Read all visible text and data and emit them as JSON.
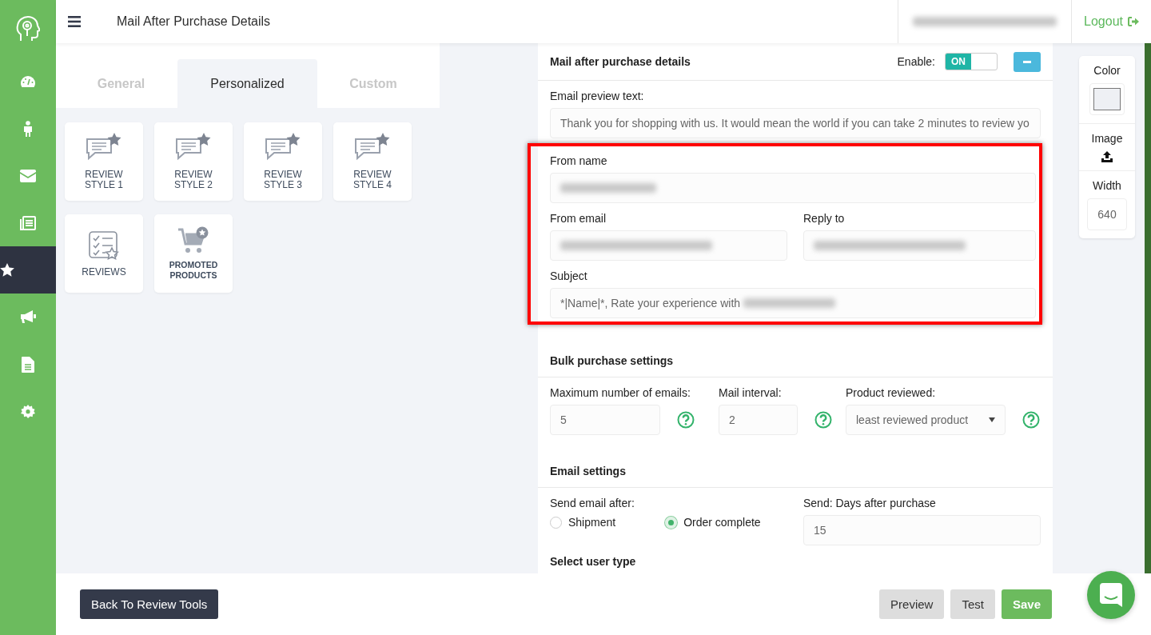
{
  "sidebar": {
    "items": [
      {
        "selected": false
      },
      {
        "selected": false
      },
      {
        "selected": false
      },
      {
        "selected": false
      },
      {
        "selected": true
      },
      {
        "selected": false
      },
      {
        "selected": false
      },
      {
        "selected": false
      }
    ]
  },
  "header": {
    "title": "Mail After Purchase Details",
    "logout": "Logout"
  },
  "tabs": [
    {
      "label": "General",
      "selected": false
    },
    {
      "label": "Personalized",
      "selected": true
    },
    {
      "label": "Custom",
      "selected": false
    }
  ],
  "templates": [
    {
      "label": "REVIEW STYLE 1",
      "kind": "speech"
    },
    {
      "label": "REVIEW STYLE 2",
      "kind": "speech"
    },
    {
      "label": "REVIEW STYLE 3",
      "kind": "speech"
    },
    {
      "label": "REVIEW STYLE 4",
      "kind": "speech"
    },
    {
      "label": "REVIEWS",
      "kind": "checklist"
    },
    {
      "label": "PROMOTED PRODUCTS",
      "kind": "cart"
    }
  ],
  "form": {
    "title": "Mail after purchase details",
    "enable_label": "Enable:",
    "toggle": {
      "label": "ON",
      "on": true
    },
    "preview_label": "Email preview text:",
    "preview_value": "Thank you for shopping with us. It would mean the world if you can take 2 minutes to review yo",
    "from_name_label": "From name",
    "from_email_label": "From email",
    "reply_to_label": "Reply to",
    "subject_label": "Subject",
    "subject_value": "*|Name|*, Rate your experience with",
    "bulk_title": "Bulk purchase settings",
    "bulk_fields": [
      {
        "label": "Maximum number of emails:",
        "value": "5",
        "kind": "input"
      },
      {
        "label": "Mail interval:",
        "value": "2",
        "kind": "input"
      },
      {
        "label": "Product reviewed:",
        "value": "least reviewed product",
        "kind": "select"
      }
    ],
    "email_title": "Email settings",
    "send_after_label": "Send email after:",
    "radios": [
      {
        "label": "Shipment",
        "selected": false
      },
      {
        "label": "Order complete",
        "selected": true
      }
    ],
    "days_label": "Send: Days after purchase",
    "days_value": "15",
    "next_section": "Select user type"
  },
  "side_panel": {
    "color_label": "Color",
    "image_label": "Image",
    "width_label": "Width",
    "width_value": "640"
  },
  "footer": {
    "back": "Back To Review Tools",
    "buttons": [
      {
        "label": "Preview",
        "kind": "secondary"
      },
      {
        "label": "Test",
        "kind": "secondary"
      },
      {
        "label": "Save",
        "kind": "primary"
      }
    ]
  }
}
